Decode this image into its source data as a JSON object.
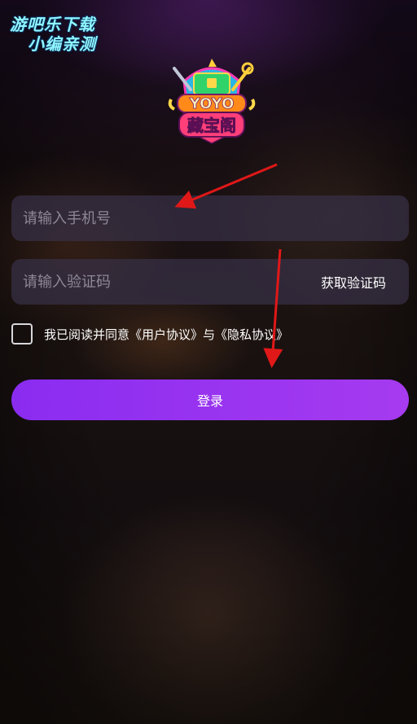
{
  "watermark": {
    "line1": "游吧乐下载",
    "line2": "小编亲测"
  },
  "logo": {
    "top_text": "YOYO",
    "bottom_text": "藏宝阁"
  },
  "phone_input": {
    "placeholder": "请输入手机号",
    "value": ""
  },
  "code_input": {
    "placeholder": "请输入验证码",
    "value": "",
    "get_code_label": "获取验证码"
  },
  "agreement": {
    "checked": false,
    "text": "我已阅读并同意《用户协议》与《隐私协议》"
  },
  "login_button": {
    "label": "登录"
  },
  "colors": {
    "accent": "#9a34f0",
    "annotation_arrow": "#e01818"
  }
}
